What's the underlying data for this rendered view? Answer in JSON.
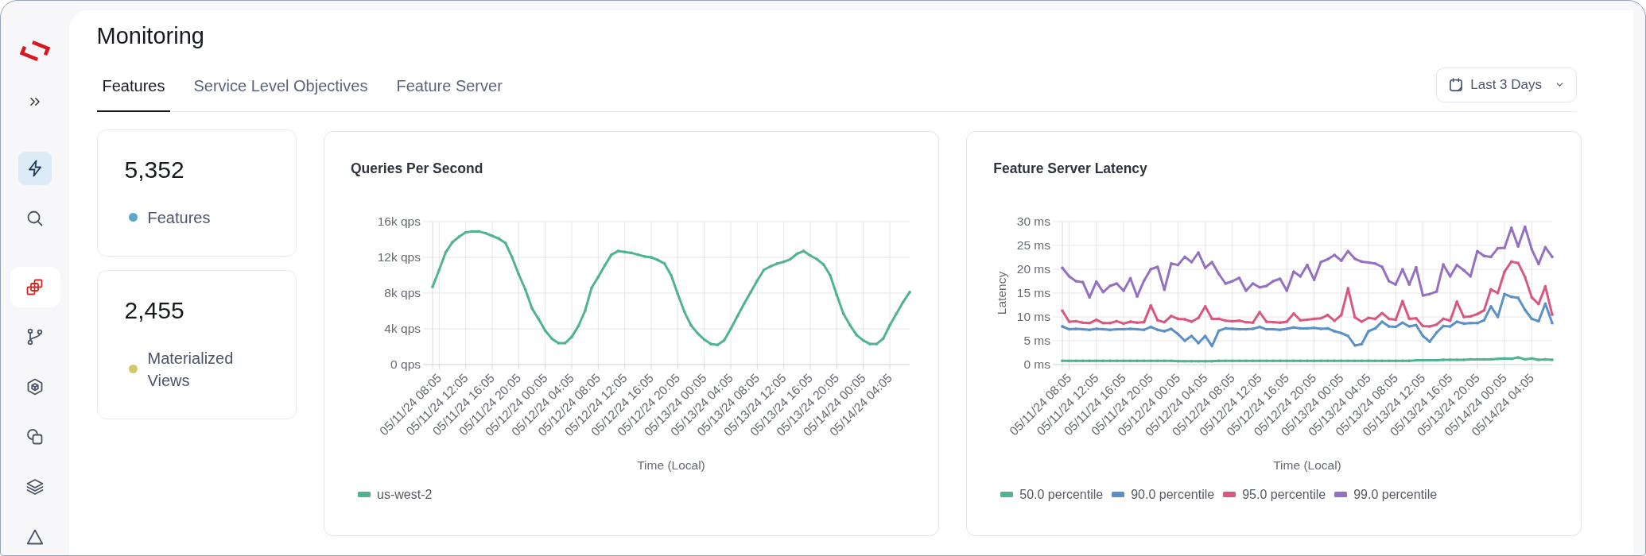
{
  "page": {
    "title": "Monitoring"
  },
  "sidebar": {
    "items": [
      {
        "kind": "nav",
        "selected": true
      },
      {
        "kind": "nav",
        "selected": false
      },
      {
        "kind": "workspace",
        "selected": false
      },
      {
        "kind": "nav",
        "selected": false
      },
      {
        "kind": "nav",
        "selected": false
      },
      {
        "kind": "nav",
        "selected": false
      },
      {
        "kind": "nav",
        "selected": false
      },
      {
        "kind": "nav",
        "selected": false
      }
    ]
  },
  "tabs": [
    {
      "label": "Features",
      "selected": true
    },
    {
      "label": "Service Level Objectives",
      "selected": false
    },
    {
      "label": "Feature Server",
      "selected": false
    }
  ],
  "date_range": {
    "label": "Last 3 Days"
  },
  "stats": [
    {
      "value": "5,352",
      "label": "Features",
      "color": "#5aa7c7"
    },
    {
      "value": "2,455",
      "label": "Materialized Views",
      "color": "#d3c86b"
    }
  ],
  "charts": [
    {
      "chart_data": {
        "type": "line",
        "title": "Queries Per Second",
        "xlabel": "Time (Local)",
        "grid": true,
        "categories": [
          null,
          "05/11/24 08:05",
          null,
          null,
          null,
          "05/11/24 12:05",
          null,
          null,
          null,
          "05/11/24 16:05",
          null,
          null,
          null,
          "05/11/24 20:05",
          null,
          null,
          null,
          "05/12/24 00:05",
          null,
          null,
          null,
          "05/12/24 04:05",
          null,
          null,
          null,
          "05/12/24 08:05",
          null,
          null,
          null,
          "05/12/24 12:05",
          null,
          null,
          null,
          "05/12/24 16:05",
          null,
          null,
          null,
          "05/12/24 20:05",
          null,
          null,
          null,
          "05/13/24 00:05",
          null,
          null,
          null,
          "05/13/24 04:05",
          null,
          null,
          null,
          "05/13/24 08:05",
          null,
          null,
          null,
          "05/13/24 12:05",
          null,
          null,
          null,
          "05/13/24 16:05",
          null,
          null,
          null,
          "05/13/24 20:05",
          null,
          null,
          null,
          "05/14/24 00:05",
          null,
          null,
          null,
          "05/14/24 04:05",
          null,
          null,
          null
        ],
        "series": [
          {
            "name": "us-west-2",
            "color": "#52b394",
            "values": [
              8.7,
              10.6,
              12.6,
              13.7,
              14.3,
              14.8,
              14.9,
              14.9,
              14.7,
              14.4,
              14.1,
              13.6,
              12.0,
              10.1,
              8.4,
              6.3,
              5.1,
              3.8,
              2.9,
              2.4,
              2.4,
              3.1,
              4.3,
              6.0,
              8.6,
              9.8,
              11.1,
              12.3,
              12.7,
              12.6,
              12.5,
              12.3,
              12.1,
              12.0,
              11.7,
              11.3,
              10.0,
              7.9,
              5.9,
              4.4,
              3.5,
              2.8,
              2.3,
              2.2,
              2.7,
              4.0,
              5.4,
              6.8,
              8.1,
              9.4,
              10.6,
              11.0,
              11.3,
              11.5,
              11.8,
              12.4,
              12.7,
              12.2,
              11.8,
              11.2,
              10.0,
              7.8,
              5.7,
              4.4,
              3.3,
              2.7,
              2.3,
              2.3,
              2.9,
              4.4,
              5.7,
              7.0,
              8.1
            ]
          }
        ],
        "ylim": [
          0,
          16
        ],
        "yticks": [
          {
            "value": 0,
            "label": "0 qps"
          },
          {
            "value": 4,
            "label": "4k qps"
          },
          {
            "value": 8,
            "label": "8k qps"
          },
          {
            "value": 12,
            "label": "12k qps"
          },
          {
            "value": 16,
            "label": "16k qps"
          }
        ]
      }
    },
    {
      "chart_data": {
        "type": "line",
        "title": "Feature Server Latency",
        "xlabel": "Time (Local)",
        "ylabel": "Latency",
        "grid": true,
        "categories": [
          null,
          "05/11/24 08:05",
          null,
          null,
          null,
          "05/11/24 12:05",
          null,
          null,
          null,
          "05/11/24 16:05",
          null,
          null,
          null,
          "05/11/24 20:05",
          null,
          null,
          null,
          "05/12/24 00:05",
          null,
          null,
          null,
          "05/12/24 04:05",
          null,
          null,
          null,
          "05/12/24 08:05",
          null,
          null,
          null,
          "05/12/24 12:05",
          null,
          null,
          null,
          "05/12/24 16:05",
          null,
          null,
          null,
          "05/12/24 20:05",
          null,
          null,
          null,
          "05/13/24 00:05",
          null,
          null,
          null,
          "05/13/24 04:05",
          null,
          null,
          null,
          "05/13/24 08:05",
          null,
          null,
          null,
          "05/13/24 12:05",
          null,
          null,
          null,
          "05/13/24 16:05",
          null,
          null,
          null,
          "05/13/24 20:05",
          null,
          null,
          null,
          "05/14/24 00:05",
          null,
          null,
          null,
          "05/14/24 04:05",
          null,
          null,
          null
        ],
        "series": [
          {
            "name": "50.0 percentile",
            "color": "#52b394",
            "values": [
              0.8,
              0.8,
              0.8,
              0.8,
              0.8,
              0.8,
              0.8,
              0.8,
              0.8,
              0.8,
              0.8,
              0.8,
              0.8,
              0.8,
              0.8,
              0.8,
              0.8,
              0.7,
              0.7,
              0.7,
              0.7,
              0.7,
              0.7,
              0.8,
              0.8,
              0.8,
              0.8,
              0.8,
              0.8,
              0.8,
              0.8,
              0.8,
              0.8,
              0.8,
              0.8,
              0.8,
              0.8,
              0.8,
              0.8,
              0.8,
              0.8,
              0.8,
              0.8,
              0.8,
              0.8,
              0.8,
              0.8,
              0.8,
              0.8,
              0.8,
              0.8,
              0.8,
              0.9,
              0.9,
              0.9,
              0.9,
              1.0,
              1.0,
              1.0,
              1.0,
              1.1,
              1.1,
              1.1,
              1.1,
              1.2,
              1.3,
              1.2,
              1.5,
              1.1,
              1.3,
              1.0,
              1.1,
              1.0
            ]
          },
          {
            "name": "90.0 percentile",
            "color": "#5b91c6",
            "values": [
              8.0,
              7.4,
              7.5,
              7.4,
              7.3,
              7.5,
              7.4,
              7.3,
              7.4,
              7.4,
              7.5,
              7.4,
              7.3,
              7.9,
              7.3,
              7.0,
              7.5,
              6.4,
              5.0,
              6.0,
              4.5,
              6.0,
              3.9,
              7.1,
              7.6,
              7.5,
              7.4,
              7.4,
              7.5,
              7.9,
              7.4,
              7.4,
              7.3,
              7.5,
              7.8,
              7.6,
              7.6,
              7.7,
              7.5,
              7.6,
              7.0,
              6.6,
              6.0,
              4.0,
              4.3,
              7.0,
              7.6,
              9.0,
              8.0,
              7.9,
              8.8,
              8.0,
              8.3,
              6.0,
              4.8,
              6.7,
              8.1,
              8.0,
              9.0,
              8.6,
              8.7,
              8.7,
              9.3,
              12.2,
              10.0,
              14.8,
              14.2,
              14.0,
              11.5,
              9.6,
              9.1,
              12.8,
              8.7
            ]
          },
          {
            "name": "95.0 percentile",
            "color": "#d8587f",
            "values": [
              11.3,
              9.0,
              9.1,
              8.8,
              8.7,
              9.4,
              8.7,
              8.7,
              9.1,
              8.6,
              9.0,
              8.8,
              8.9,
              12.4,
              9.3,
              8.9,
              10.2,
              9.6,
              9.5,
              9.0,
              9.8,
              12.2,
              9.6,
              9.6,
              9.2,
              9.1,
              9.2,
              8.9,
              8.8,
              11.0,
              9.0,
              8.9,
              8.8,
              9.0,
              10.7,
              9.3,
              9.4,
              9.6,
              9.7,
              10.4,
              9.2,
              10.4,
              16.0,
              9.9,
              9.0,
              9.8,
              9.6,
              10.8,
              9.6,
              9.4,
              13.3,
              9.6,
              9.7,
              8.1,
              8.0,
              8.4,
              9.6,
              9.2,
              13.2,
              10.0,
              10.1,
              10.6,
              11.4,
              15.8,
              15.0,
              19.5,
              21.6,
              21.3,
              18.4,
              14.1,
              12.7,
              16.4,
              10.5
            ]
          },
          {
            "name": "99.0 percentile",
            "color": "#9571c1",
            "values": [
              20.3,
              18.5,
              17.5,
              17.3,
              14.1,
              17.4,
              15.2,
              16.5,
              17.0,
              15.5,
              18.1,
              14.3,
              17.6,
              20.0,
              20.5,
              15.7,
              21.2,
              20.9,
              22.6,
              21.5,
              23.5,
              20.3,
              21.5,
              19.0,
              17.0,
              17.5,
              18.2,
              15.5,
              17.0,
              16.2,
              16.5,
              17.5,
              18.0,
              15.5,
              19.5,
              18.5,
              20.9,
              17.8,
              21.5,
              22.1,
              23.0,
              21.8,
              23.8,
              22.2,
              21.6,
              21.4,
              21.2,
              20.5,
              17.5,
              16.8,
              20.0,
              16.8,
              20.4,
              14.5,
              14.8,
              15.3,
              21.0,
              18.5,
              20.9,
              19.8,
              18.5,
              23.8,
              22.8,
              22.6,
              24.4,
              24.5,
              28.7,
              24.8,
              28.9,
              24.2,
              21.1,
              24.6,
              22.6
            ]
          }
        ],
        "ylim": [
          0,
          30
        ],
        "yticks": [
          {
            "value": 0,
            "label": "0 ms"
          },
          {
            "value": 5,
            "label": "5 ms"
          },
          {
            "value": 10,
            "label": "10 ms"
          },
          {
            "value": 15,
            "label": "15 ms"
          },
          {
            "value": 20,
            "label": "20 ms"
          },
          {
            "value": 25,
            "label": "25 ms"
          },
          {
            "value": 30,
            "label": "30 ms"
          }
        ]
      }
    }
  ]
}
